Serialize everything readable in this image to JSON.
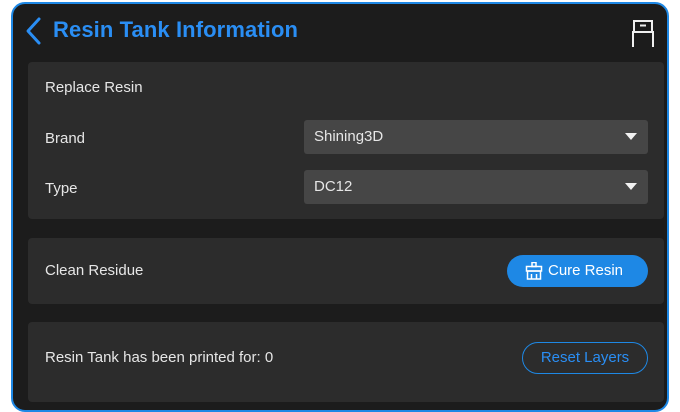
{
  "header": {
    "title": "Resin Tank Information",
    "back_icon": "chevron-left-icon",
    "printer_icon": "printer-icon"
  },
  "replace": {
    "section_label": "Replace Resin",
    "brand_label": "Brand",
    "brand_value": "Shining3D",
    "type_label": "Type",
    "type_value": "DC12"
  },
  "clean": {
    "label": "Clean Residue",
    "button_label": "Cure Resin",
    "button_icon": "broom-icon"
  },
  "tank": {
    "label": "Resin Tank has been printed for: 0",
    "button_label": "Reset Layers"
  },
  "colors": {
    "accent": "#1e88e5",
    "background": "#1c1c1c",
    "card": "#2c2c2c",
    "select": "#464646"
  }
}
